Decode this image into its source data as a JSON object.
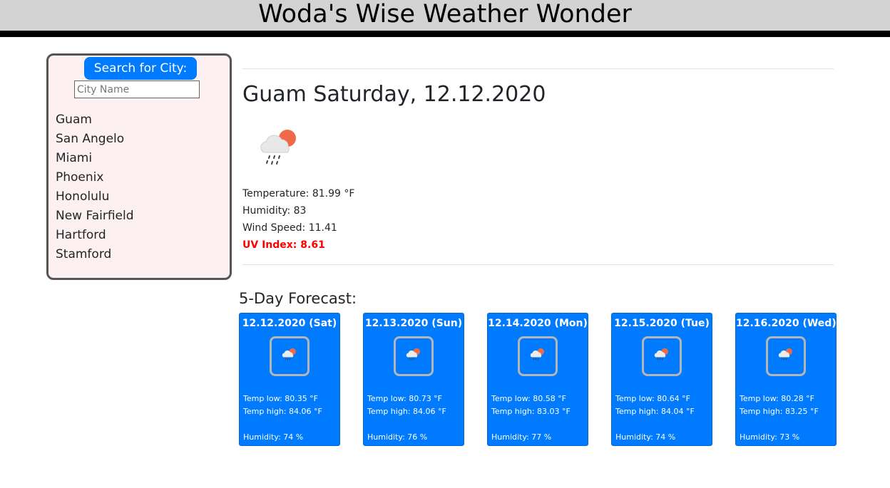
{
  "header": {
    "title": "Woda's Wise Weather Wonder"
  },
  "sidebar": {
    "search_label": "Search for City:",
    "input_placeholder": "City Name",
    "input_value": "",
    "cities": [
      "Guam",
      "San Angelo",
      "Miami",
      "Phoenix",
      "Honolulu",
      "New Fairfield",
      "Hartford",
      "Stamford"
    ]
  },
  "current": {
    "title": "Guam Saturday, 12.12.2020",
    "icon": "cloud-rain-sun-icon",
    "temperature": "Temperature: 81.99 °F",
    "humidity": "Humidity: 83",
    "wind": "Wind Speed: 11.41",
    "uv": "UV Index: 8.61",
    "uv_color": "#ff0000"
  },
  "forecast": {
    "title": "5-Day Forecast:",
    "card_color": "#007bff",
    "days": [
      {
        "date": "12.12.2020 (Sat)",
        "low": "Temp low: 80.35 °F",
        "high": "Temp high: 84.06 °F",
        "humidity": "Humidity: 74 %",
        "icon": "cloud-rain-sun-icon"
      },
      {
        "date": "12.13.2020 (Sun)",
        "low": "Temp low: 80.73 °F",
        "high": "Temp high: 84.06 °F",
        "humidity": "Humidity: 76 %",
        "icon": "cloud-rain-sun-icon"
      },
      {
        "date": "12.14.2020 (Mon)",
        "low": "Temp low: 80.58 °F",
        "high": "Temp high: 83.03 °F",
        "humidity": "Humidity: 77 %",
        "icon": "cloud-rain-sun-icon"
      },
      {
        "date": "12.15.2020 (Tue)",
        "low": "Temp low: 80.64 °F",
        "high": "Temp high: 84.04 °F",
        "humidity": "Humidity: 74 %",
        "icon": "cloud-rain-sun-icon"
      },
      {
        "date": "12.16.2020 (Wed)",
        "low": "Temp low: 80.28 °F",
        "high": "Temp high: 83.25 °F",
        "humidity": "Humidity: 73 %",
        "icon": "cloud-rain-sun-icon"
      }
    ]
  }
}
